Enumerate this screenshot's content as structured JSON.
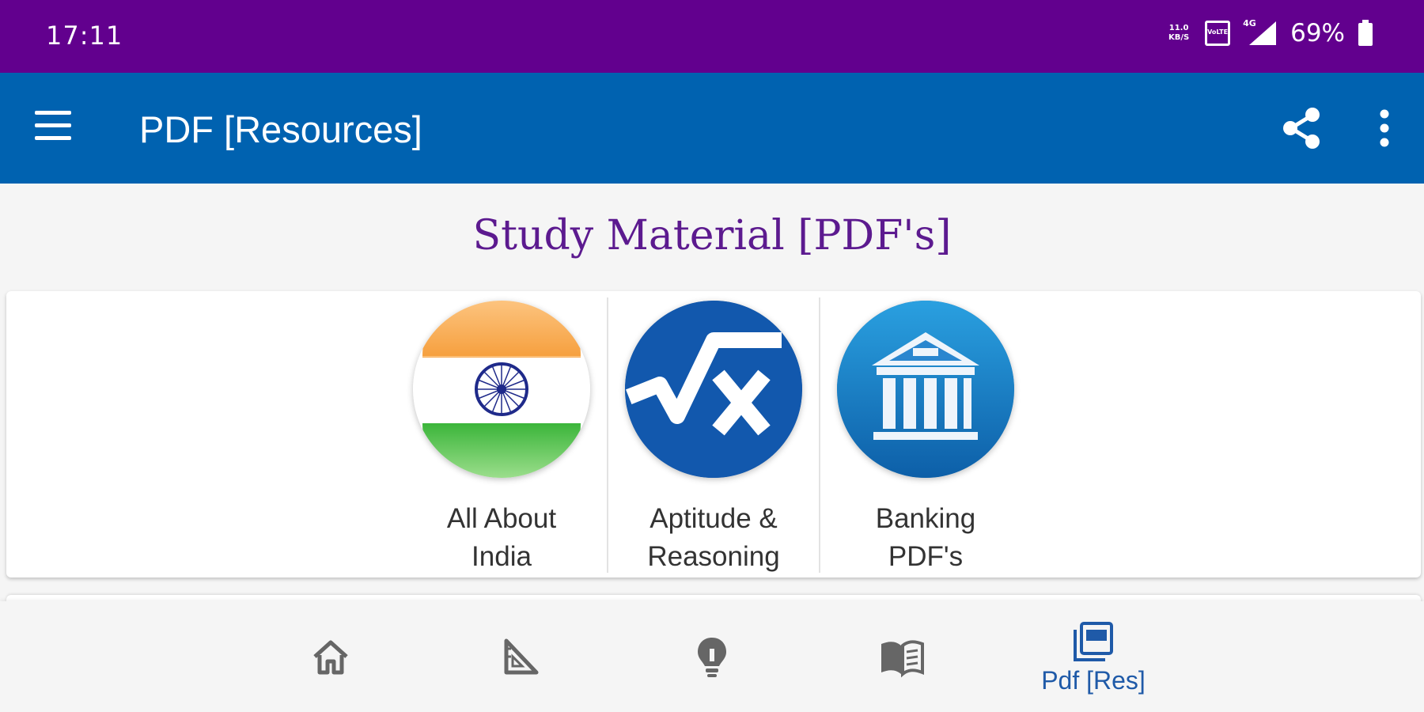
{
  "status_bar": {
    "time": "17:11",
    "net_speed": "11.0 KB/S",
    "volte": "VoLTE",
    "network": "4G",
    "battery": "69%",
    "icons": [
      "net-speed-icon",
      "volte-icon",
      "signal-icon",
      "battery-icon"
    ]
  },
  "app_bar": {
    "title": "PDF [Resources]",
    "icons": [
      "menu-icon",
      "share-icon",
      "more-vert-icon"
    ]
  },
  "section_title": "Study Material [PDF's]",
  "tiles": [
    {
      "line1": "All About",
      "line2": "India",
      "icon": "india-flag-icon"
    },
    {
      "line1": "Aptitude &",
      "line2": "Reasoning",
      "icon": "square-root-x-icon"
    },
    {
      "line1": "Banking",
      "line2": "PDF's",
      "icon": "bank-icon"
    }
  ],
  "bottom_nav": {
    "items": [
      {
        "icon": "home-icon"
      },
      {
        "icon": "set-square-icon"
      },
      {
        "icon": "lightbulb-icon"
      },
      {
        "icon": "book-icon"
      },
      {
        "icon": "pdf-stack-icon",
        "label": "Pdf [Res]",
        "active": true
      }
    ]
  },
  "colors": {
    "status_bar": "#62008e",
    "app_bar": "#0062b0",
    "section_title": "#5c1a8f",
    "active_nav": "#1f5aa8",
    "inactive_nav": "#666666"
  }
}
